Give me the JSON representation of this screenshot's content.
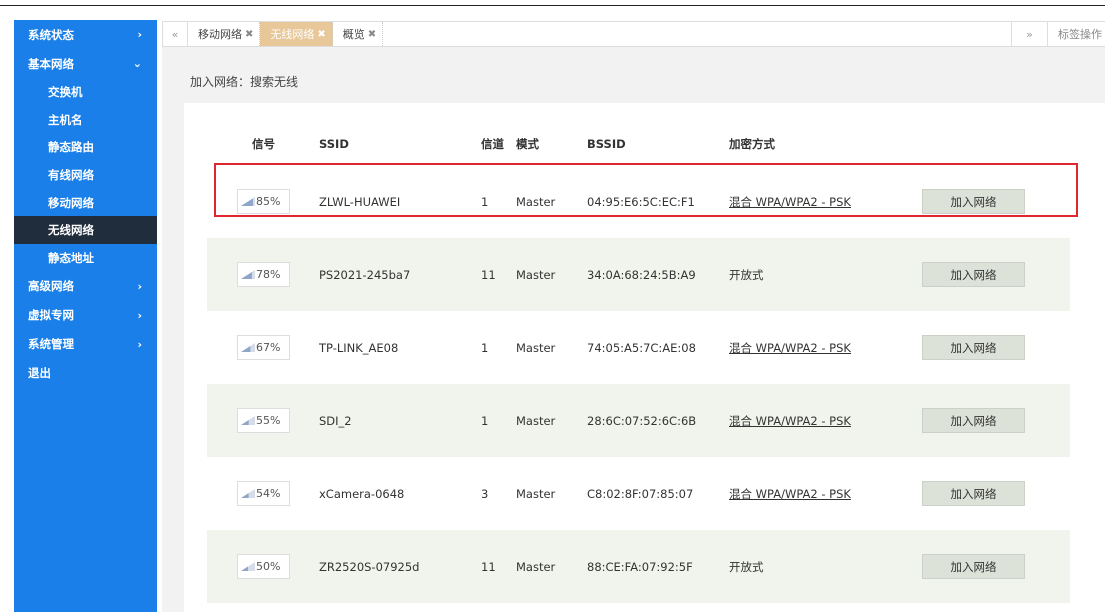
{
  "sidebar": {
    "items": [
      {
        "label": "系统状态",
        "chevron": "›"
      },
      {
        "label": "基本网络",
        "chevron": "⌄"
      }
    ],
    "sub_items": [
      "交换机",
      "主机名",
      "静态路由",
      "有线网络",
      "移动网络",
      "无线网络",
      "静态地址"
    ],
    "active_sub": "无线网络",
    "bottom_items": [
      {
        "label": "高级网络",
        "chevron": "›"
      },
      {
        "label": "虚拟专网",
        "chevron": "›"
      },
      {
        "label": "系统管理",
        "chevron": "›"
      },
      {
        "label": "退出",
        "chevron": ""
      }
    ]
  },
  "tabbar": {
    "prev_icon": "«",
    "tabs": [
      {
        "label": "移动网络",
        "close": "✖"
      },
      {
        "label": "无线网络",
        "close": "✖"
      },
      {
        "label": "概览",
        "close": "✖"
      }
    ],
    "active_tab": "无线网络",
    "next_icon": "»",
    "ops_label": "标签操作 ▾"
  },
  "breadcrumb": "加入网络：搜索无线",
  "table": {
    "headers": [
      "信号",
      "SSID",
      "信道",
      "模式",
      "BSSID",
      "加密方式"
    ],
    "rows": [
      {
        "signal": "85%",
        "signal_level": 0.85,
        "ssid": "ZLWL-HUAWEI",
        "channel": "1",
        "mode": "Master",
        "bssid": "04:95:E6:5C:EC:F1",
        "encryption": "混合 WPA/WPA2 - PSK",
        "enc_link": true,
        "action": "加入网络"
      },
      {
        "signal": "78%",
        "signal_level": 0.78,
        "ssid": "PS2021-245ba7",
        "channel": "11",
        "mode": "Master",
        "bssid": "34:0A:68:24:5B:A9",
        "encryption": "开放式",
        "enc_link": false,
        "action": "加入网络"
      },
      {
        "signal": "67%",
        "signal_level": 0.67,
        "ssid": "TP-LINK_AE08",
        "channel": "1",
        "mode": "Master",
        "bssid": "74:05:A5:7C:AE:08",
        "encryption": "混合 WPA/WPA2 - PSK",
        "enc_link": true,
        "action": "加入网络"
      },
      {
        "signal": "55%",
        "signal_level": 0.55,
        "ssid": "SDI_2",
        "channel": "1",
        "mode": "Master",
        "bssid": "28:6C:07:52:6C:6B",
        "encryption": "混合 WPA/WPA2 - PSK",
        "enc_link": true,
        "action": "加入网络"
      },
      {
        "signal": "54%",
        "signal_level": 0.54,
        "ssid": "xCamera-0648",
        "channel": "3",
        "mode": "Master",
        "bssid": "C8:02:8F:07:85:07",
        "encryption": "混合 WPA/WPA2 - PSK",
        "enc_link": true,
        "action": "加入网络"
      },
      {
        "signal": "50%",
        "signal_level": 0.5,
        "ssid": "ZR2520S-07925d",
        "channel": "11",
        "mode": "Master",
        "bssid": "88:CE:FA:07:92:5F",
        "encryption": "开放式",
        "enc_link": false,
        "action": "加入网络"
      }
    ]
  },
  "colors": {
    "sidebar_bg": "#1a7fe8",
    "sidebar_active": "#1f2d3d",
    "active_tab": "#e8c898",
    "highlight": "#e0262e",
    "signal_fill": "#8fa6c8",
    "signal_empty": "#d6dde8"
  }
}
